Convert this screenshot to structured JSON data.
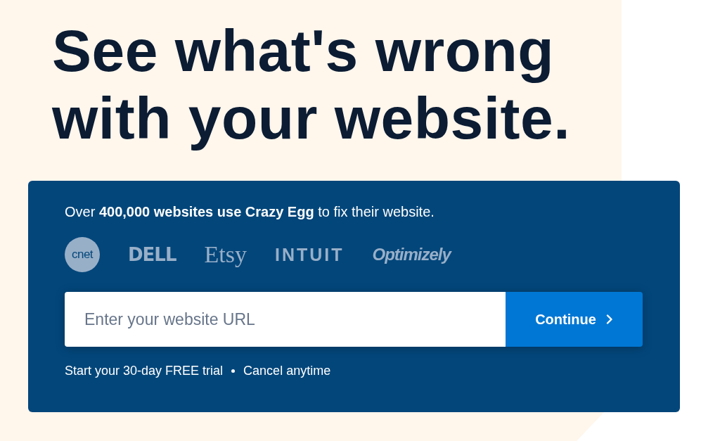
{
  "headline": "See what's wrong with your website.",
  "card": {
    "intro": "Over **400,000 websites use Crazy Egg** to fix their website.",
    "logos": [
      {
        "kind": "circle",
        "label": "cnet"
      },
      {
        "kind": "block",
        "label": "DELL"
      },
      {
        "kind": "serif",
        "label": "Etsy"
      },
      {
        "kind": "wide",
        "label": "INTUIT"
      },
      {
        "kind": "italic",
        "label": "Optimizely"
      }
    ],
    "url_field": {
      "placeholder": "Enter your website URL"
    },
    "button": {
      "label": "Continue"
    },
    "notes": [
      "Start your 30-day FREE trial",
      "Cancel anytime"
    ]
  }
}
